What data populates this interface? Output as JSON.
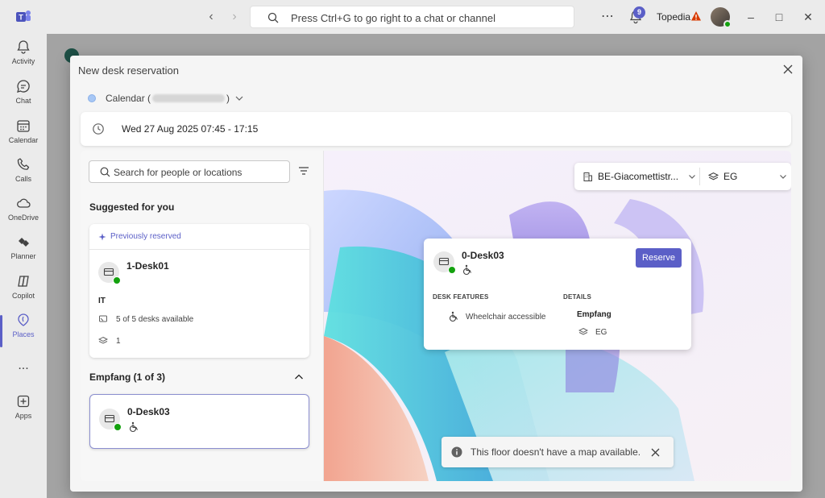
{
  "titlebar": {
    "search_placeholder": "Press Ctrl+G to go right to a chat or channel",
    "notifications_count": "9",
    "org_name": "Topedia"
  },
  "rail": {
    "items": [
      {
        "label": "Activity",
        "icon": "bell-icon"
      },
      {
        "label": "Chat",
        "icon": "chat-icon"
      },
      {
        "label": "Calendar",
        "icon": "calendar-icon"
      },
      {
        "label": "Calls",
        "icon": "phone-icon"
      },
      {
        "label": "OneDrive",
        "icon": "cloud-icon"
      },
      {
        "label": "Planner",
        "icon": "planner-icon"
      },
      {
        "label": "Copilot",
        "icon": "copilot-icon"
      },
      {
        "label": "Places",
        "icon": "places-icon"
      },
      {
        "label": "Apps",
        "icon": "apps-icon"
      }
    ],
    "more": "..."
  },
  "modal": {
    "title": "New desk reservation",
    "calendar_label": "Calendar (",
    "calendar_suffix": ")",
    "datetime": "Wed 27 Aug 2025 07:45 - 17:15",
    "search_placeholder": "Search for people or locations",
    "suggested_heading": "Suggested for you",
    "suggested_card": {
      "tag": "Previously reserved",
      "desk_name": "1-Desk01",
      "group": "IT",
      "availability": "5 of 5 desks available",
      "floor": "1"
    },
    "group_heading": "Empfang (1 of 3)",
    "group_card": {
      "desk_name": "0-Desk03"
    },
    "location_picker": {
      "building": "BE-Giacomettistr...",
      "floor": "EG"
    },
    "popup": {
      "desk_name": "0-Desk03",
      "reserve_label": "Reserve",
      "features_caption": "DESK FEATURES",
      "feature": "Wheelchair accessible",
      "details_caption": "DETAILS",
      "details_area": "Empfang",
      "details_floor": "EG"
    },
    "toast": "This floor doesn't have a map available."
  },
  "colors": {
    "brand": "#5b5fc7",
    "available": "#13a10e"
  }
}
